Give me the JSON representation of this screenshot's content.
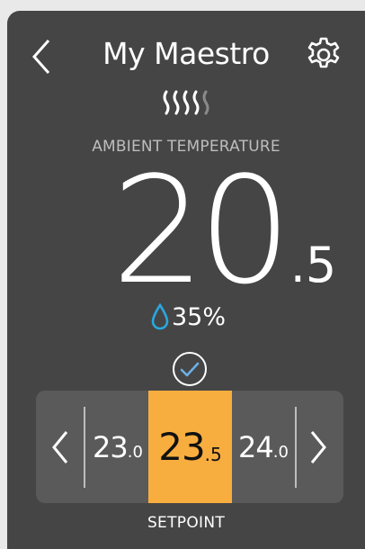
{
  "header": {
    "title": "My Maestro"
  },
  "ambient": {
    "label": "AMBIENT TEMPERATURE",
    "temp_integer": "20",
    "temp_decimal": ".5",
    "humidity": "35%"
  },
  "setpoint": {
    "label": "SETPOINT",
    "options": [
      {
        "integer": "23",
        "decimal": ".0"
      },
      {
        "integer": "23",
        "decimal": ".5"
      },
      {
        "integer": "24",
        "decimal": ".0"
      }
    ],
    "selected_index": 1
  },
  "colors": {
    "panel": "#454545",
    "accent": "#f8ad3f",
    "humidity_drop": "#29a8e0",
    "confirm_check": "#6cb0e6"
  },
  "icons": [
    "back-chevron-icon",
    "gear-icon",
    "heating-waves-icon",
    "water-drop-icon",
    "check-circle-icon",
    "chevron-left-icon",
    "chevron-right-icon"
  ]
}
